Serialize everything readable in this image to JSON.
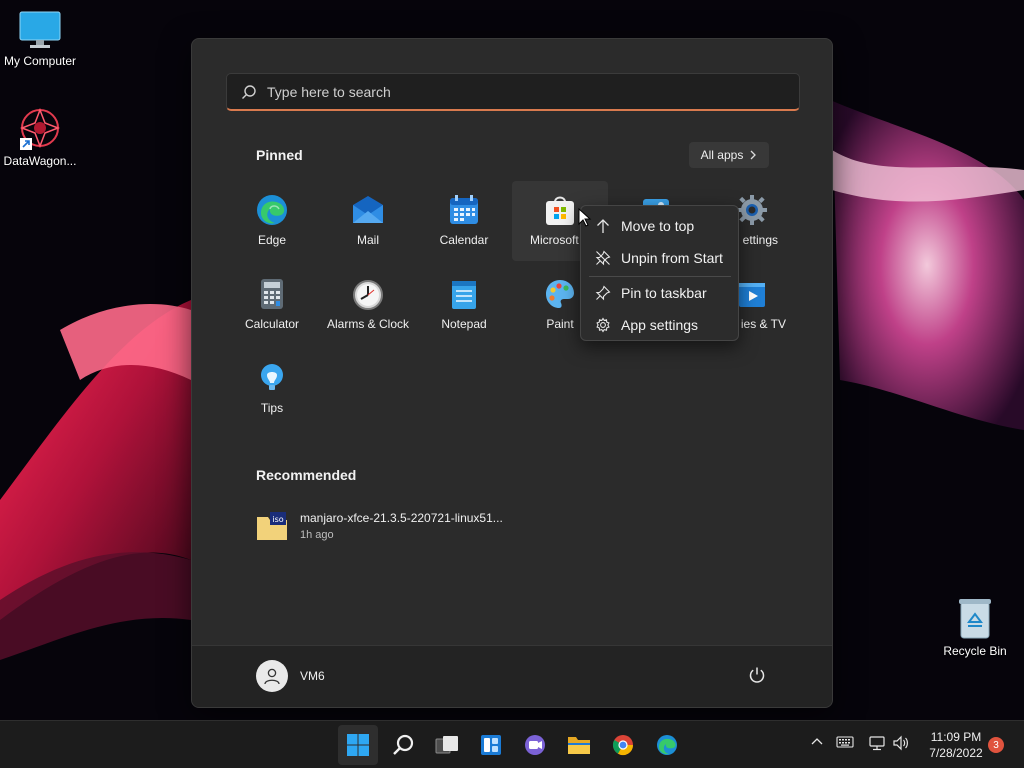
{
  "desktop": {
    "icons": [
      {
        "label": "My Computer"
      },
      {
        "label": "DataWagon..."
      },
      {
        "label": "Recycle Bin"
      }
    ]
  },
  "start_menu": {
    "search_placeholder": "Type here to search",
    "pinned_title": "Pinned",
    "all_apps_label": "All apps",
    "pinned_apps": [
      {
        "label": "Edge"
      },
      {
        "label": "Mail"
      },
      {
        "label": "Calendar"
      },
      {
        "label": "Microsoft S"
      },
      {
        "label": ""
      },
      {
        "label": "ettings"
      },
      {
        "label": "Calculator"
      },
      {
        "label": "Alarms & Clock"
      },
      {
        "label": "Notepad"
      },
      {
        "label": "Paint"
      },
      {
        "label": "ies & TV"
      },
      {
        "label": "Tips"
      }
    ],
    "recommended_title": "Recommended",
    "recommended": [
      {
        "name": "manjaro-xfce-21.3.5-220721-linux51...",
        "time": "1h ago"
      }
    ],
    "user_name": "VM6"
  },
  "context_menu": {
    "items": [
      {
        "label": "Move to top"
      },
      {
        "label": "Unpin from Start"
      },
      {
        "label": "Pin to taskbar"
      },
      {
        "label": "App settings"
      }
    ]
  },
  "taskbar": {
    "time": "11:09 PM",
    "date": "7/28/2022",
    "notification_count": "3"
  },
  "colors": {
    "accent": "#d97a4e",
    "start_bg": "#2b2b2b",
    "taskbar_bg": "#1c1c1c"
  }
}
